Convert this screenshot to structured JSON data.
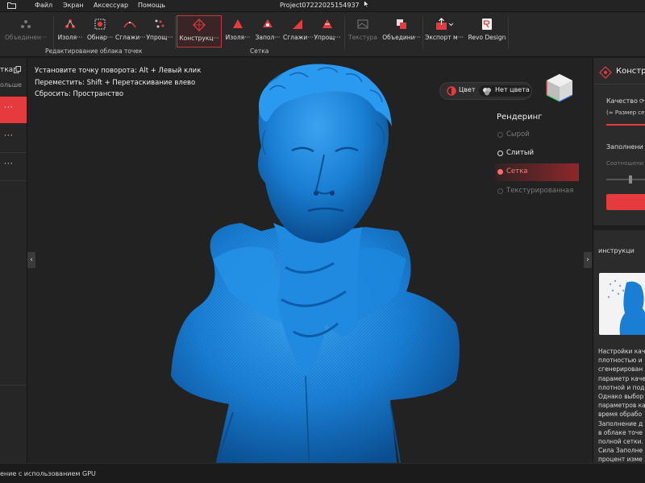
{
  "menubar": {
    "items": [
      "Файл",
      "Экран",
      "Аксессуар",
      "Помощь"
    ],
    "title": "Project07222025154937"
  },
  "ribbon": {
    "group1_label": "Редактирование облака точек",
    "group2_label": "Сетка",
    "tools": [
      {
        "label": "Объединен···"
      },
      {
        "label": "Изоля···"
      },
      {
        "label": "Обнар···"
      },
      {
        "label": "Сглажи···"
      },
      {
        "label": "Упрощ···"
      },
      {
        "label": "Конструкц···"
      },
      {
        "label": "Изоля···"
      },
      {
        "label": "Запол···"
      },
      {
        "label": "Сглажи···"
      },
      {
        "label": "Упрощ···"
      },
      {
        "label": "Текстура"
      },
      {
        "label": "Объедини···"
      },
      {
        "label": "Экспорт м···"
      },
      {
        "label": "Revo Design"
      }
    ]
  },
  "leftpanel": {
    "title": "тка",
    "subtitle": "ольше",
    "rows": [
      "···",
      "···",
      "···"
    ]
  },
  "viewport": {
    "hints": [
      "Установите точку поворота: Alt + Левый клик",
      "Переместить: Shift + Перетаскивание влево",
      "Сбросить: Пространство"
    ],
    "color_toggle": {
      "color": "Цвет",
      "no_color": "Нет цвета"
    },
    "rendering": {
      "title": "Рендеринг",
      "options": [
        "Сырой",
        "Слитый",
        "Сетка",
        "Текстурированная"
      ],
      "selected": "Сетка"
    },
    "nav_left": "‹",
    "nav_right": "›",
    "mesh_color": "#1a7fd4"
  },
  "rightpanel": {
    "title": "Констр",
    "quality": "Качество",
    "size_hint": "(≈ Размер сет",
    "fill": "Заполнени",
    "ratio": "Соотношени",
    "instructions": "инструкци",
    "paragraph": [
      "Настройки кач",
      "плотностью и",
      "сгенерирован",
      "параметр каче",
      "плотной и под",
      "Однако выбор",
      "параметров ка",
      "время обрабо",
      "Заполнение д",
      "в облаке точе",
      "полной сетки.",
      "Сила Заполне",
      "процент изме"
    ]
  },
  "statusbar": {
    "text": "ение с использованием GPU"
  },
  "colors": {
    "accent": "#e53b3f",
    "mesh": "#1a7fd4",
    "background": "#222222"
  }
}
